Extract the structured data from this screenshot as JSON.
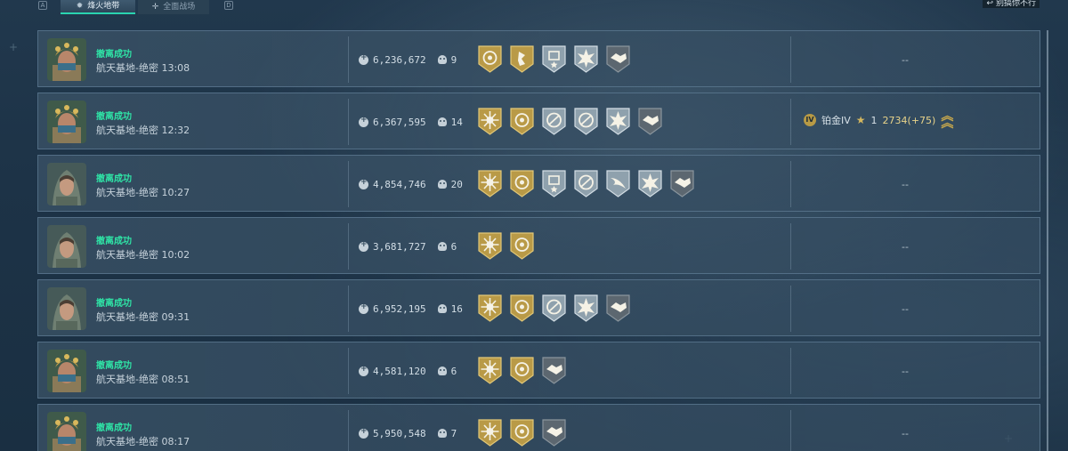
{
  "tabs": [
    {
      "key": "A",
      "label": "烽火地带",
      "icon": "flame-icon",
      "active": true
    },
    {
      "label": "全面战场",
      "icon": "crosshair-icon",
      "active": false,
      "key": "D"
    }
  ],
  "top_right": {
    "icon": "back-arrow-icon",
    "label": "别搞你不行"
  },
  "records": [
    {
      "avatar": "helmet-soldier",
      "status": "撤离成功",
      "map_time": "航天基地-绝密 13:08",
      "assets": "6,236,672",
      "kills": "9",
      "badges": [
        "gold-target",
        "gold-rider",
        "silver-shield-star",
        "silver-burst",
        "gray-handshake"
      ],
      "rank": null,
      "empty": "--"
    },
    {
      "avatar": "helmet-soldier",
      "status": "撤离成功",
      "map_time": "航天基地-绝密 12:32",
      "assets": "6,367,595",
      "kills": "14",
      "badges": [
        "gold-sun",
        "gold-target",
        "silver-no-sign",
        "silver-no-sign",
        "silver-burst",
        "gray-handshake"
      ],
      "rank": {
        "icon_text": "IV",
        "label": "铂金IV",
        "stars": "1",
        "score": "2734(+75)"
      },
      "empty": ""
    },
    {
      "avatar": "hooded-woman",
      "status": "撤离成功",
      "map_time": "航天基地-绝密 10:27",
      "assets": "4,854,746",
      "kills": "20",
      "badges": [
        "gold-sun",
        "gold-target",
        "silver-shield-star",
        "silver-no-sign",
        "silver-wing",
        "silver-burst",
        "gray-handshake"
      ],
      "rank": null,
      "empty": "--"
    },
    {
      "avatar": "hooded-woman",
      "status": "撤离成功",
      "map_time": "航天基地-绝密 10:02",
      "assets": "3,681,727",
      "kills": "6",
      "badges": [
        "gold-sun",
        "gold-target"
      ],
      "rank": null,
      "empty": "--"
    },
    {
      "avatar": "hooded-woman",
      "status": "撤离成功",
      "map_time": "航天基地-绝密 09:31",
      "assets": "6,952,195",
      "kills": "16",
      "badges": [
        "gold-sun",
        "gold-target",
        "silver-no-sign",
        "silver-burst",
        "gray-handshake"
      ],
      "rank": null,
      "empty": "--"
    },
    {
      "avatar": "helmet-soldier",
      "status": "撤离成功",
      "map_time": "航天基地-绝密 08:51",
      "assets": "4,581,120",
      "kills": "6",
      "badges": [
        "gold-sun",
        "gold-target",
        "gray-handshake"
      ],
      "rank": null,
      "empty": "--"
    },
    {
      "avatar": "helmet-soldier",
      "status": "撤离成功",
      "map_time": "航天基地-绝密 08:17",
      "assets": "5,950,548",
      "kills": "7",
      "badges": [
        "gold-sun",
        "gold-target",
        "gray-handshake"
      ],
      "rank": null,
      "empty": "--"
    }
  ],
  "colors": {
    "status_success": "#2fe3a6",
    "badge_gold": "#b99a47",
    "badge_silver": "#8fa1ad",
    "badge_gray": "#5c6770",
    "tab_accent": "#2ad4b0"
  }
}
